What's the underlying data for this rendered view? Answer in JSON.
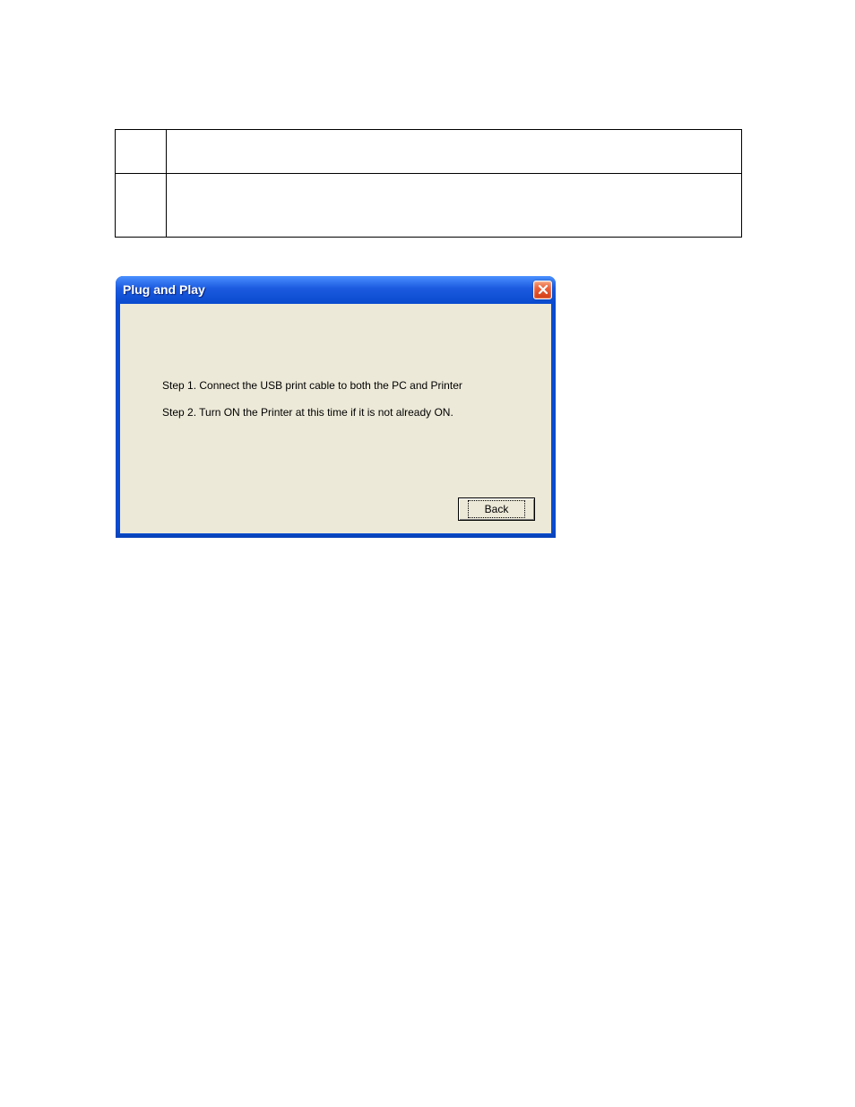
{
  "dialog": {
    "title": "Plug and Play",
    "step1": "Step 1.  Connect the USB print cable to both the PC and Printer",
    "step2": "Step 2.  Turn ON the Printer at this time if it is not already ON.",
    "back_label": "Back"
  }
}
